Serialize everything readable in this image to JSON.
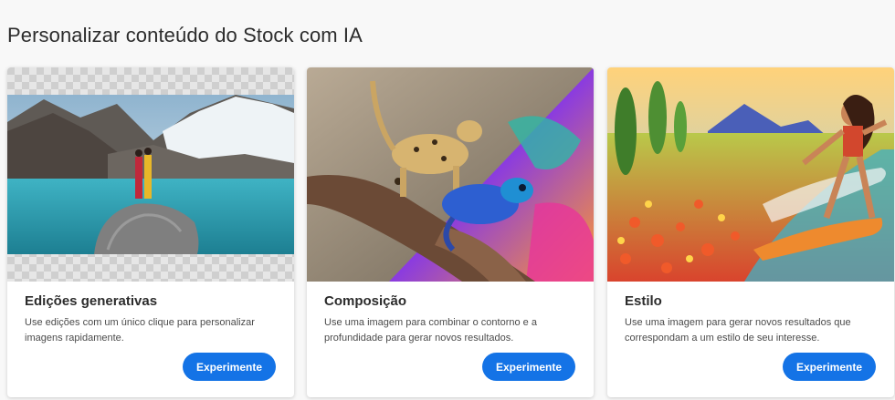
{
  "page": {
    "title": "Personalizar conteúdo do Stock com IA"
  },
  "cards": [
    {
      "title": "Edições generativas",
      "description": "Use edições com um único clique para personalizar imagens rapidamente.",
      "button_label": "Experimente",
      "image": "mountain-lake-couple-on-rock"
    },
    {
      "title": "Composição",
      "description": "Use uma imagem para combinar o contorno e a profundidade para gerar novos resultados.",
      "button_label": "Experimente",
      "image": "cheetah-and-chameleon-on-branch"
    },
    {
      "title": "Estilo",
      "description": "Use uma imagem para gerar novos resultados que correspondam a um estilo de seu interesse.",
      "button_label": "Experimente",
      "image": "painted-surfer-woman-flower-field"
    }
  ],
  "colors": {
    "accent": "#1473e6",
    "background": "#f8f8f8"
  }
}
